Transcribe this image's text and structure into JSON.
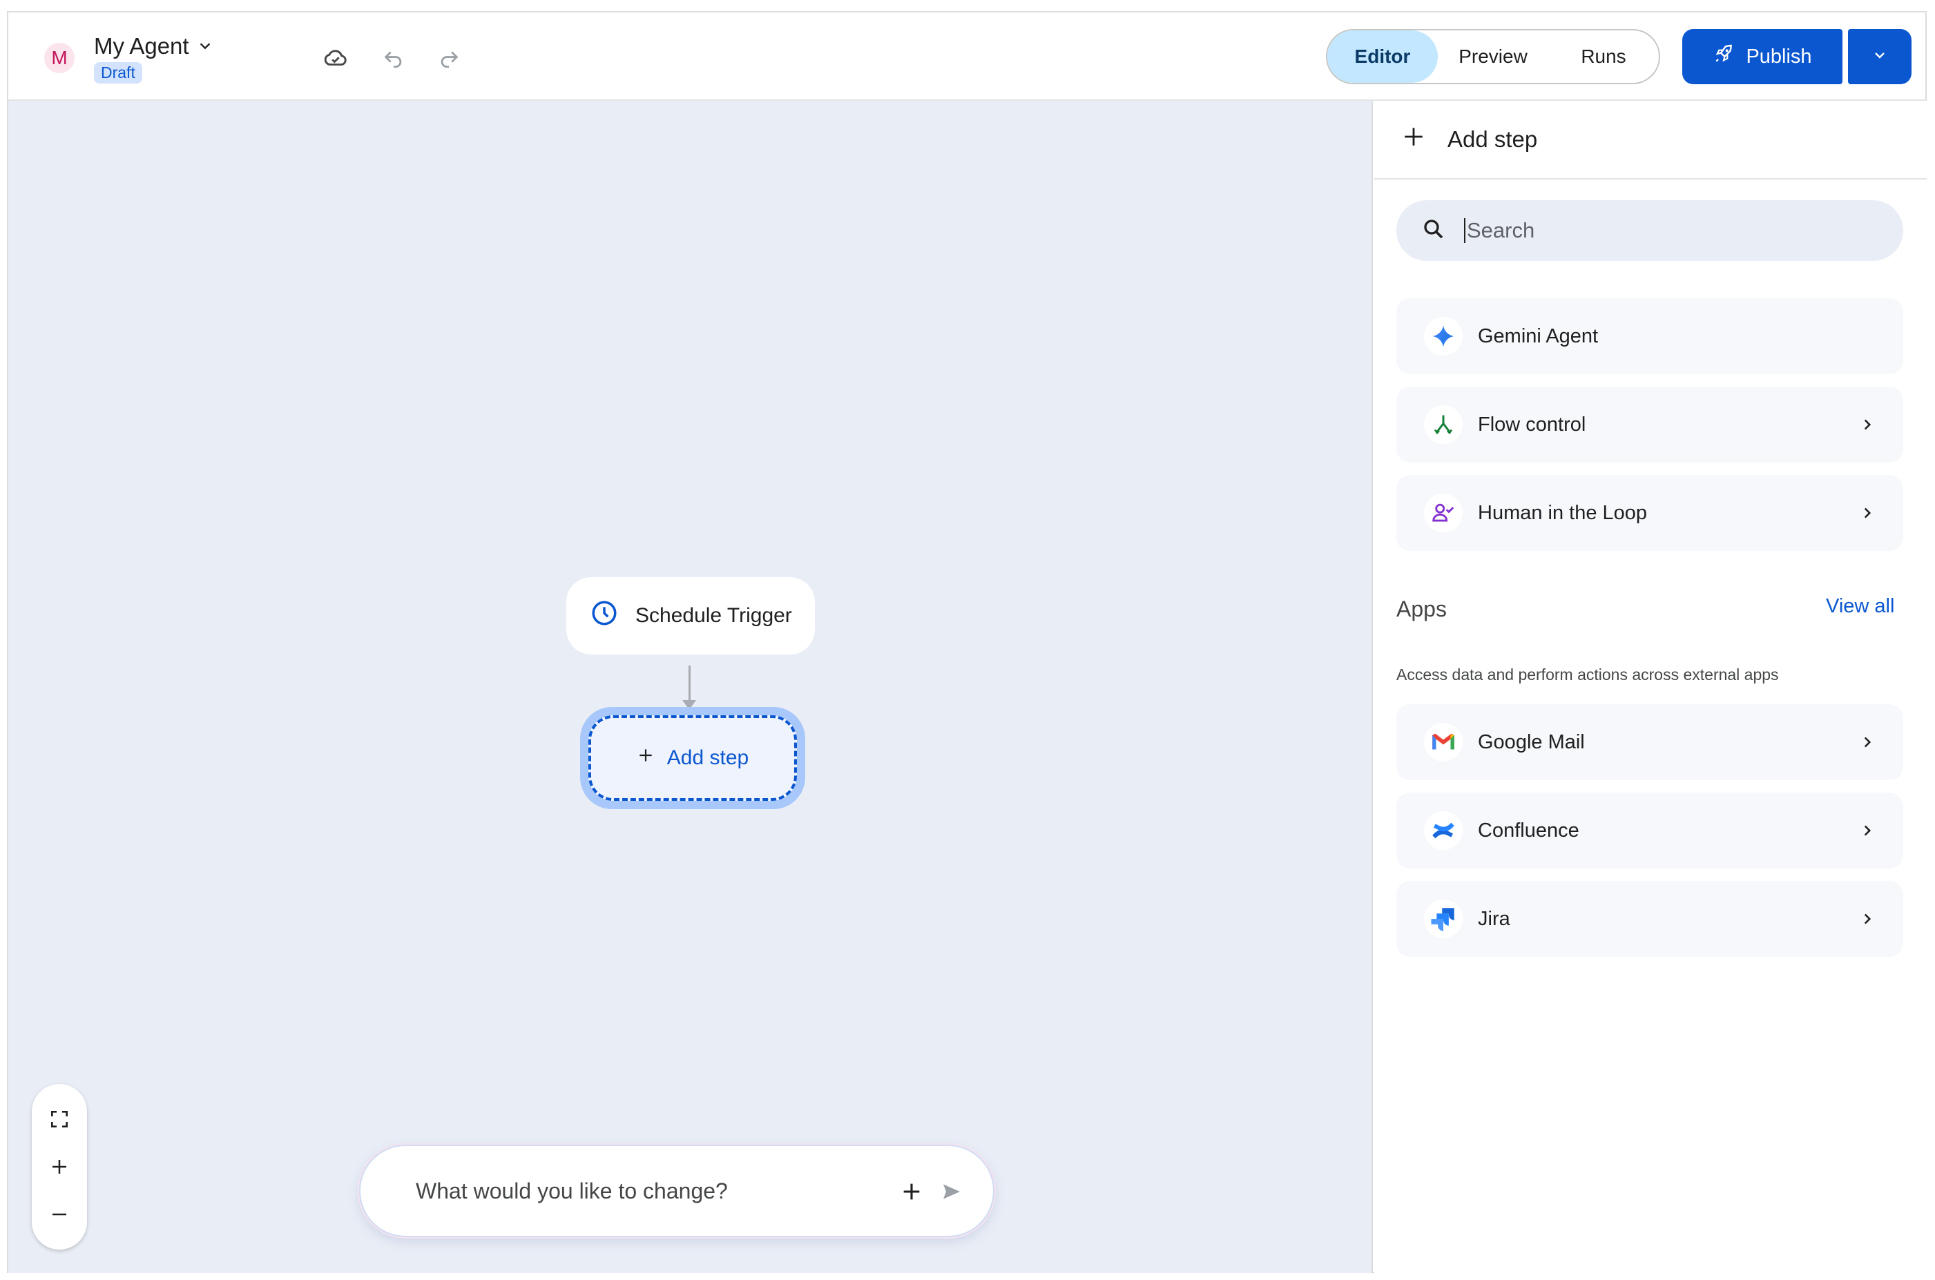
{
  "header": {
    "avatar_letter": "M",
    "agent_name": "My Agent",
    "status_badge": "Draft",
    "tabs": [
      {
        "label": "Editor",
        "active": true
      },
      {
        "label": "Preview",
        "active": false
      },
      {
        "label": "Runs",
        "active": false
      }
    ],
    "publish_label": "Publish"
  },
  "canvas": {
    "trigger_node": "Schedule Trigger",
    "add_step_node": "Add step",
    "chat_placeholder": "What would you like to change?"
  },
  "panel": {
    "title": "Add step",
    "search_placeholder": "Search",
    "items": [
      {
        "label": "Gemini Agent",
        "icon": "sparkle-icon",
        "has_chevron": false
      },
      {
        "label": "Flow control",
        "icon": "flow-branch-icon",
        "has_chevron": true
      },
      {
        "label": "Human in the Loop",
        "icon": "person-check-icon",
        "has_chevron": true
      }
    ],
    "apps": {
      "title": "Apps",
      "view_all": "View all",
      "subtitle": "Access data and perform actions across external apps",
      "items": [
        {
          "label": "Google Mail",
          "icon": "gmail-icon"
        },
        {
          "label": "Confluence",
          "icon": "confluence-icon"
        },
        {
          "label": "Jira",
          "icon": "jira-icon"
        }
      ]
    }
  },
  "colors": {
    "primary": "#0b57d0",
    "canvas_bg": "#e9edf5",
    "active_tab_bg": "#c2e7ff",
    "flow_icon": "#188038",
    "human_icon": "#8430ce"
  }
}
